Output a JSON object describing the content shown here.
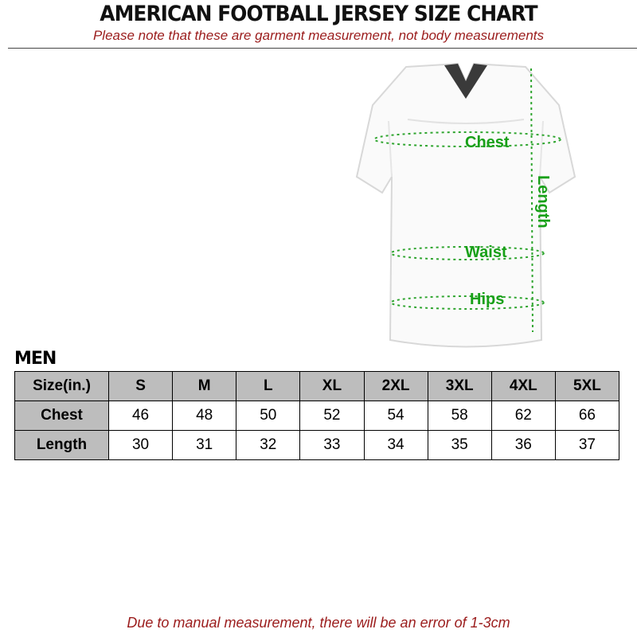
{
  "header": {
    "title": "AMERICAN FOOTBALL JERSEY SIZE CHART",
    "subtitle": "Please note that these are garment measurement, not body measurements"
  },
  "jersey_labels": {
    "chest": "Chest",
    "waist": "Waist",
    "hips": "Hips",
    "length": "Length"
  },
  "colors": {
    "accent_red": "#9b1c1c",
    "measure_green": "#18a018",
    "table_header_gray": "#bdbdbd"
  },
  "section_label": "MEN",
  "table": {
    "header": [
      "Size(in.)",
      "S",
      "M",
      "L",
      "XL",
      "2XL",
      "3XL",
      "4XL",
      "5XL"
    ],
    "rows": [
      [
        "Chest",
        "46",
        "48",
        "50",
        "52",
        "54",
        "58",
        "62",
        "66"
      ],
      [
        "Length",
        "30",
        "31",
        "32",
        "33",
        "34",
        "35",
        "36",
        "37"
      ]
    ]
  },
  "footer": "Due to manual measurement, there will be an error of 1-3cm"
}
